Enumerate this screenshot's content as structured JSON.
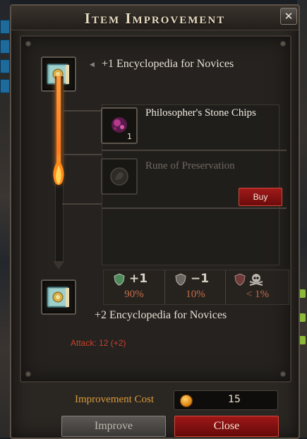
{
  "window": {
    "title": "Item Improvement",
    "close_glyph": "✕"
  },
  "source_item": {
    "name": "+1 Encyclopedia for Novices",
    "icon": "encyclopedia-book-icon"
  },
  "result_item": {
    "name": "+2 Encyclopedia for Novices",
    "icon": "encyclopedia-book-icon",
    "stat_line": "Attack: 12 (+2)"
  },
  "materials": [
    {
      "name": "Philosopher's Stone Chips",
      "quantity": "1",
      "icon": "purple-stone-chips-icon",
      "available": true
    },
    {
      "name": "Rune of Preservation",
      "icon": "rune-icon",
      "available": false,
      "buy_label": "Buy"
    }
  ],
  "outcomes": [
    {
      "label": "+1",
      "chance": "90%",
      "icon": "shield-icon-green"
    },
    {
      "label": "−1",
      "chance": "10%",
      "icon": "shield-icon-grey"
    },
    {
      "label": "",
      "chance": "< 1%",
      "icon": "shield-skull-icon"
    }
  ],
  "footer": {
    "cost_label": "Improvement Cost",
    "cost_value": "15",
    "cost_icon": "gold-coin-icon",
    "improve_label": "Improve",
    "close_label": "Close"
  },
  "progress": {
    "fill_fraction": 0.58,
    "color": "#ff8b2c"
  },
  "colors": {
    "accent_gold": "#d99a3a",
    "danger_red": "#a01a1a",
    "attack_red": "#c8422c",
    "chance_orange": "#c46b4a"
  }
}
